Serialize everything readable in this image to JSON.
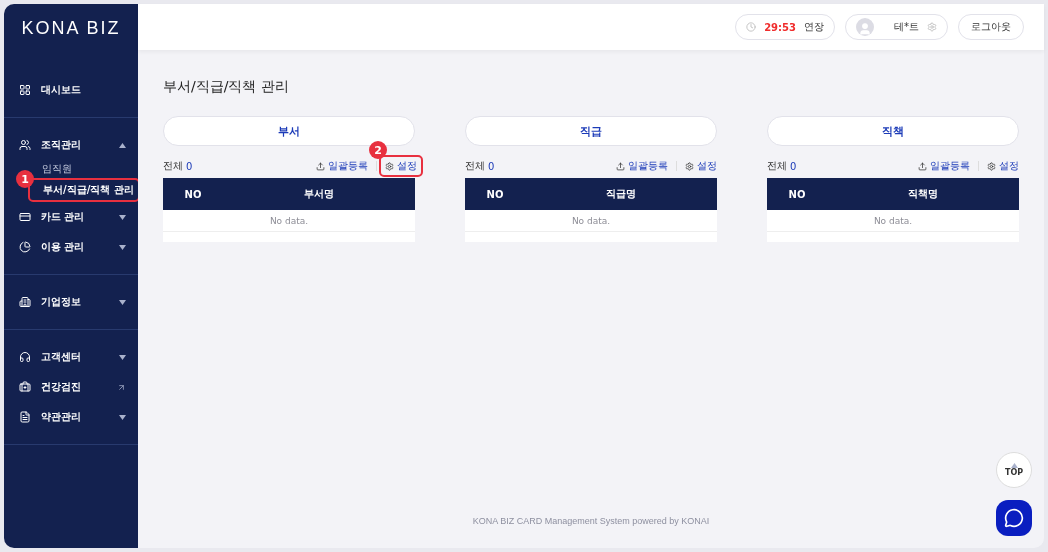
{
  "sidebar": {
    "logo": "KONA BIZ",
    "sections": [
      [
        {
          "label": "대시보드",
          "kind": "link"
        }
      ],
      [
        {
          "label": "조직관리",
          "kind": "menu",
          "expanded": true,
          "children": [
            {
              "label": "임직원",
              "selected": false
            },
            {
              "label": "부서/직급/직책 관리",
              "selected": true,
              "annotation": "1"
            }
          ]
        },
        {
          "label": "카드 관리",
          "kind": "menu",
          "expanded": false
        },
        {
          "label": "이용 관리",
          "kind": "menu",
          "expanded": false
        }
      ],
      [
        {
          "label": "기업정보",
          "kind": "menu",
          "expanded": false
        }
      ],
      [
        {
          "label": "고객센터",
          "kind": "menu",
          "expanded": false
        },
        {
          "label": "건강검진",
          "kind": "external"
        },
        {
          "label": "약관관리",
          "kind": "menu",
          "expanded": false
        }
      ]
    ]
  },
  "header": {
    "timer": "29:53",
    "extend": "연장",
    "user": "테*트",
    "logout": "로그아웃"
  },
  "page_title": "부서/직급/직책 관리",
  "panels": [
    {
      "title": "부서",
      "total_label": "전체",
      "total": "0",
      "bulk": "일괄등록",
      "settings": "설정",
      "settings_annotation": "2",
      "columns": [
        "NO",
        "부서명"
      ],
      "empty": "No data."
    },
    {
      "title": "직급",
      "total_label": "전체",
      "total": "0",
      "bulk": "일괄등록",
      "settings": "설정",
      "columns": [
        "NO",
        "직급명"
      ],
      "empty": "No data."
    },
    {
      "title": "직책",
      "total_label": "전체",
      "total": "0",
      "bulk": "일괄등록",
      "settings": "설정",
      "columns": [
        "NO",
        "직책명"
      ],
      "empty": "No data."
    }
  ],
  "footer": "KONA BIZ CARD Management System powered by KONAI",
  "top_button": "TOP"
}
